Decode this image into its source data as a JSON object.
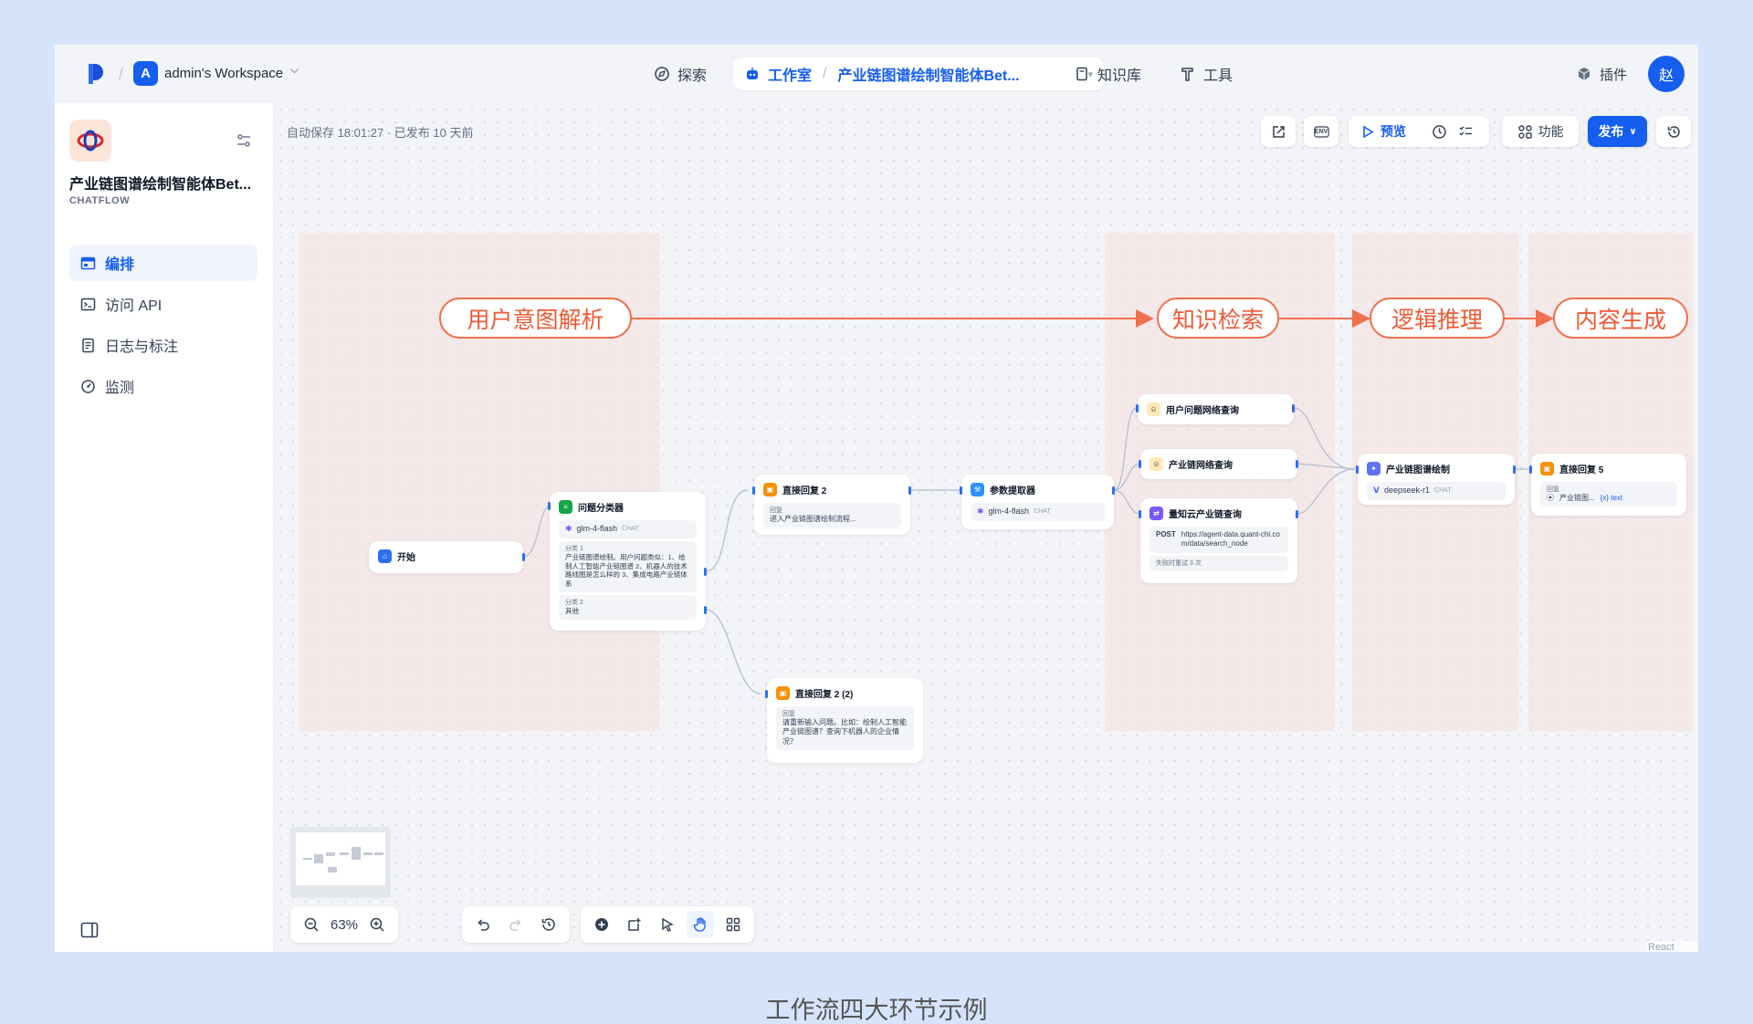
{
  "workspace": {
    "avatar_letter": "A",
    "name": "admin's Workspace"
  },
  "nav": {
    "explore": "探索",
    "studio": "工作室",
    "app_title": "产业链图谱绘制智能体Bet...",
    "knowledge": "知识库",
    "tools": "工具",
    "plugins": "插件",
    "user_avatar": "赵"
  },
  "app": {
    "name": "产业链图谱绘制智能体Bet...",
    "type": "CHATFLOW"
  },
  "sidebar_menu": [
    {
      "label": "编排",
      "icon": "layout-icon",
      "active": true
    },
    {
      "label": "访问 API",
      "icon": "terminal-icon",
      "active": false
    },
    {
      "label": "日志与标注",
      "icon": "file-list-icon",
      "active": false
    },
    {
      "label": "监测",
      "icon": "dashboard-icon",
      "active": false
    }
  ],
  "canvas": {
    "autosave": "自动保存 18:01:27 · 已发布 10 天前",
    "toolbar": {
      "env": "ENV",
      "preview": "预览",
      "features": "功能",
      "publish": "发布"
    },
    "zoom": "63%",
    "react_flow": "React Flow"
  },
  "stages": [
    "用户意图解析",
    "知识检索",
    "逻辑推理",
    "内容生成"
  ],
  "nodes": {
    "start": {
      "title": "开始"
    },
    "classifier": {
      "title": "问题分类器",
      "model": "glm-4-flash",
      "model_tag": "CHAT",
      "class1_label": "分类 1",
      "class1_text": "产业链图谱绘制。用户问题类似：1、绘制人工智能产业链图谱 2、机器人的技术路线图是怎么样的 3、集成电路产业链体系",
      "class2_label": "分类 2",
      "class2_text": "其他"
    },
    "reply2": {
      "title": "直接回复 2",
      "label": "回复",
      "text": "进入产业链图谱绘制流程..."
    },
    "reply2b": {
      "title": "直接回复 2 (2)",
      "label": "回复",
      "text": "请重新输入问题。比如：绘制人工智能产业链图谱？查询下机器人的企业情况？"
    },
    "param": {
      "title": "参数提取器",
      "model": "glm-4-flash",
      "model_tag": "CHAT"
    },
    "search1": {
      "title": "用户问题网络查询"
    },
    "search2": {
      "title": "产业链网络查询"
    },
    "http": {
      "title": "量知云产业链查询",
      "method": "POST",
      "url": "https://agent-data.quant-chi.com/data/search_node",
      "retry": "失败时重试 3 次"
    },
    "llm": {
      "title": "产业链图谱绘制",
      "model": "deepseek-r1",
      "model_tag": "CHAT"
    },
    "reply5": {
      "title": "直接回复 5",
      "label": "回复",
      "ref": "产业链图...",
      "var": "{x} text"
    }
  },
  "caption": "工作流四大环节示例",
  "colors": {
    "accent": "#155eef",
    "stage": "#ee5a35"
  }
}
